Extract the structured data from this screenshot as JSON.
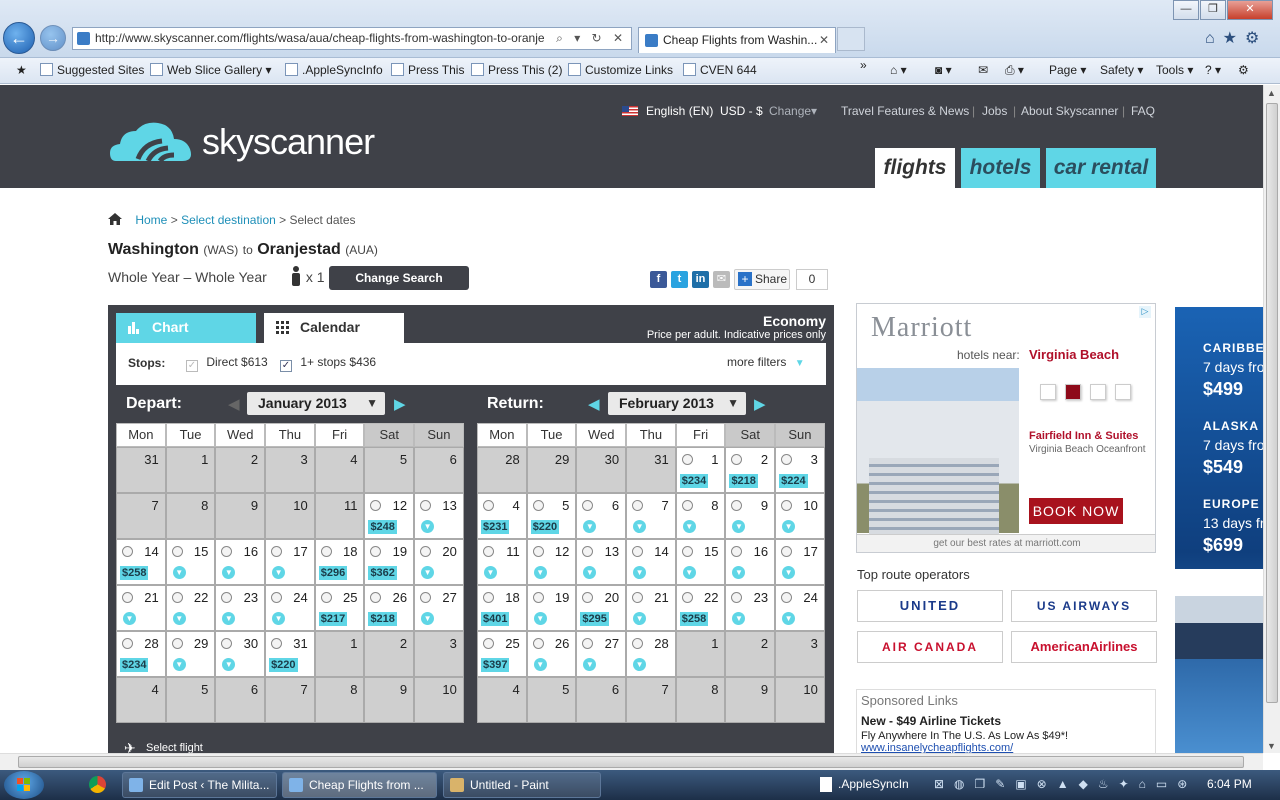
{
  "browser": {
    "address": "http://www.skyscanner.com/flights/wasa/aua/cheap-flights-from-washington-to-oranje",
    "tab_title": "Cheap Flights from Washin...",
    "address_tools": "⌕ ▾ ↻ ✕",
    "min": "—",
    "max": "❐",
    "close": "✕",
    "back": "←",
    "fwd": "→",
    "icons": "⌂★⚙"
  },
  "favorites": {
    "items": [
      "Suggested Sites",
      "Web Slice Gallery ▾",
      ".AppleSyncInfo",
      "Press This",
      "Press This (2)",
      "Customize Links",
      "CVEN 644"
    ],
    "chev": "»",
    "commands": [
      "Page ▾",
      "Safety ▾",
      "Tools ▾",
      "? ▾"
    ]
  },
  "header": {
    "logo": "skyscanner",
    "language": "English (EN)",
    "currency": "USD - $",
    "change": "Change▾",
    "links": [
      "Travel Features & News",
      "Jobs",
      "About Skyscanner",
      "FAQ"
    ],
    "seps": [
      "|",
      "|",
      "|"
    ],
    "nav": [
      "flights",
      "hotels",
      "car rental"
    ]
  },
  "breadcrumb": {
    "home": "Home",
    "sep": ">",
    "step2": "Select destination",
    "step3": "Select dates"
  },
  "route": {
    "from": "Washington",
    "from_code": "(WAS)",
    "to_word": "to",
    "to": "Oranjestad",
    "to_code": "(AUA)",
    "period": "Whole Year – Whole Year",
    "pax": "x 1",
    "change_search": "Change Search"
  },
  "share": {
    "fb": "f",
    "tw": "t",
    "li": "in",
    "em": "✉",
    "share": "Share",
    "count": "0"
  },
  "panel": {
    "tab_chart": "Chart",
    "tab_calendar": "Calendar",
    "cabin": "Economy",
    "note": "Price per adult. Indicative prices only",
    "stops_label": "Stops:",
    "direct": "Direct",
    "direct_price": "$613",
    "onestop": "1+ stops",
    "onestop_price": "$436",
    "check": "✓",
    "more_filters": "more filters",
    "filters_arrow": "▼",
    "select_flight": "Select flight",
    "plane": "✈"
  },
  "days": [
    "Mon",
    "Tue",
    "Wed",
    "Thu",
    "Fri",
    "Sat",
    "Sun"
  ],
  "arrows": {
    "left": "◀",
    "right": "▶",
    "dd": "▼",
    "down": "▼"
  },
  "depart": {
    "label": "Depart:",
    "month": "January 2013",
    "weeks": [
      [
        {
          "d": "31",
          "g": true
        },
        {
          "d": "1",
          "g": true
        },
        {
          "d": "2",
          "g": true
        },
        {
          "d": "3",
          "g": true
        },
        {
          "d": "4",
          "g": true
        },
        {
          "d": "5",
          "g": true
        },
        {
          "d": "6",
          "g": true
        }
      ],
      [
        {
          "d": "7",
          "g": true
        },
        {
          "d": "8",
          "g": true
        },
        {
          "d": "9",
          "g": true
        },
        {
          "d": "10",
          "g": true
        },
        {
          "d": "11",
          "g": true
        },
        {
          "d": "12",
          "r": true,
          "p": "$248"
        },
        {
          "d": "13",
          "r": true,
          "v": true
        }
      ],
      [
        {
          "d": "14",
          "r": true,
          "p": "$258"
        },
        {
          "d": "15",
          "r": true,
          "v": true
        },
        {
          "d": "16",
          "r": true,
          "v": true
        },
        {
          "d": "17",
          "r": true,
          "v": true
        },
        {
          "d": "18",
          "r": true,
          "p": "$296"
        },
        {
          "d": "19",
          "r": true,
          "p": "$362"
        },
        {
          "d": "20",
          "r": true,
          "v": true
        }
      ],
      [
        {
          "d": "21",
          "r": true,
          "v": true
        },
        {
          "d": "22",
          "r": true,
          "v": true
        },
        {
          "d": "23",
          "r": true,
          "v": true
        },
        {
          "d": "24",
          "r": true,
          "v": true
        },
        {
          "d": "25",
          "r": true,
          "p": "$217"
        },
        {
          "d": "26",
          "r": true,
          "p": "$218"
        },
        {
          "d": "27",
          "r": true,
          "v": true
        }
      ],
      [
        {
          "d": "28",
          "r": true,
          "p": "$234"
        },
        {
          "d": "29",
          "r": true,
          "v": true
        },
        {
          "d": "30",
          "r": true,
          "v": true
        },
        {
          "d": "31",
          "r": true,
          "p": "$220"
        },
        {
          "d": "1",
          "g": true
        },
        {
          "d": "2",
          "g": true
        },
        {
          "d": "3",
          "g": true
        }
      ],
      [
        {
          "d": "4",
          "g": true
        },
        {
          "d": "5",
          "g": true
        },
        {
          "d": "6",
          "g": true
        },
        {
          "d": "7",
          "g": true
        },
        {
          "d": "8",
          "g": true
        },
        {
          "d": "9",
          "g": true
        },
        {
          "d": "10",
          "g": true
        }
      ]
    ]
  },
  "return": {
    "label": "Return:",
    "month": "February 2013",
    "weeks": [
      [
        {
          "d": "28",
          "g": true
        },
        {
          "d": "29",
          "g": true
        },
        {
          "d": "30",
          "g": true
        },
        {
          "d": "31",
          "g": true
        },
        {
          "d": "1",
          "r": true,
          "p": "$234"
        },
        {
          "d": "2",
          "r": true,
          "p": "$218"
        },
        {
          "d": "3",
          "r": true,
          "p": "$224"
        }
      ],
      [
        {
          "d": "4",
          "r": true,
          "p": "$231"
        },
        {
          "d": "5",
          "r": true,
          "p": "$220"
        },
        {
          "d": "6",
          "r": true,
          "v": true
        },
        {
          "d": "7",
          "r": true,
          "v": true
        },
        {
          "d": "8",
          "r": true,
          "v": true
        },
        {
          "d": "9",
          "r": true,
          "v": true
        },
        {
          "d": "10",
          "r": true,
          "v": true
        }
      ],
      [
        {
          "d": "11",
          "r": true,
          "v": true
        },
        {
          "d": "12",
          "r": true,
          "v": true
        },
        {
          "d": "13",
          "r": true,
          "v": true
        },
        {
          "d": "14",
          "r": true,
          "v": true
        },
        {
          "d": "15",
          "r": true,
          "v": true
        },
        {
          "d": "16",
          "r": true,
          "v": true
        },
        {
          "d": "17",
          "r": true,
          "v": true
        }
      ],
      [
        {
          "d": "18",
          "r": true,
          "p": "$401"
        },
        {
          "d": "19",
          "r": true,
          "v": true
        },
        {
          "d": "20",
          "r": true,
          "p": "$295"
        },
        {
          "d": "21",
          "r": true,
          "v": true
        },
        {
          "d": "22",
          "r": true,
          "p": "$258"
        },
        {
          "d": "23",
          "r": true,
          "v": true
        },
        {
          "d": "24",
          "r": true,
          "v": true
        }
      ],
      [
        {
          "d": "25",
          "r": true,
          "p": "$397"
        },
        {
          "d": "26",
          "r": true,
          "v": true
        },
        {
          "d": "27",
          "r": true,
          "v": true
        },
        {
          "d": "28",
          "r": true,
          "v": true
        },
        {
          "d": "1",
          "g": true
        },
        {
          "d": "2",
          "g": true
        },
        {
          "d": "3",
          "g": true
        }
      ],
      [
        {
          "d": "4",
          "g": true
        },
        {
          "d": "5",
          "g": true
        },
        {
          "d": "6",
          "g": true
        },
        {
          "d": "7",
          "g": true
        },
        {
          "d": "8",
          "g": true
        },
        {
          "d": "9",
          "g": true
        },
        {
          "d": "10",
          "g": true
        }
      ]
    ]
  },
  "ad": {
    "brand": "Marriott",
    "near": "hotels near:",
    "city": "Virginia Beach",
    "hotel": "Fairfield Inn & Suites",
    "hotel_sub": "Virginia Beach Oceanfront",
    "cta": "BOOK NOW",
    "footer": "get our best rates at marriott.com",
    "badge": "▷"
  },
  "operators": {
    "title": "Top route operators",
    "items": [
      "UNITED",
      "US AIRWAYS",
      "AIR CANADA",
      "AmericanAirlines"
    ],
    "colors": [
      "#1a3a8a",
      "#1a3a8a",
      "#c8102e",
      "#c8102e"
    ]
  },
  "sponsored": {
    "title": "Sponsored Links",
    "headline": "New - $49 Airline Tickets",
    "desc": "Fly Anywhere In The U.S. As Low As $49*!",
    "url": "www.insanelycheapflights.com/"
  },
  "rad": [
    {
      "dest": "CARIBBEAN",
      "days": "7 days fro",
      "price": "$499"
    },
    {
      "dest": "ALASKA CR",
      "days": "7 days fro",
      "price": "$549"
    },
    {
      "dest": "EUROPE CR",
      "days": "13 days fro",
      "price": "$699"
    }
  ],
  "scroll": {
    "up": "▲",
    "down": "▼"
  },
  "taskbar": {
    "items": [
      "Edit Post ‹ The Milita...",
      "Cheap Flights from ...",
      "Untitled - Paint"
    ],
    "tray_app": ".AppleSyncIn",
    "time": "6:04 PM"
  }
}
